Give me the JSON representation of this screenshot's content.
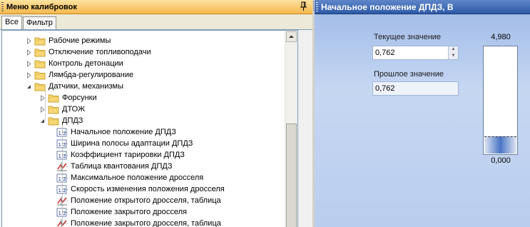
{
  "left_panel": {
    "title": "Меню калибровок",
    "tabs": [
      "Все",
      "Фильтр"
    ],
    "tree": {
      "items": [
        {
          "label": "Рабочие режимы",
          "kind": "folder"
        },
        {
          "label": "Отключение топливоподачи",
          "kind": "folder"
        },
        {
          "label": "Контроль детонации",
          "kind": "folder"
        },
        {
          "label": "Лямбда-регулирование",
          "kind": "folder"
        },
        {
          "label": "Датчики, механизмы",
          "kind": "folder"
        },
        {
          "label": "Форсунки",
          "kind": "folder"
        },
        {
          "label": "ДТОЖ",
          "kind": "folder"
        },
        {
          "label": "ДПДЗ",
          "kind": "folder"
        },
        {
          "label": "Начальное положение ДПДЗ",
          "kind": "value"
        },
        {
          "label": "Ширина полосы адаптации ДПДЗ",
          "kind": "value"
        },
        {
          "label": "Коэффициент тарировки ДПДЗ",
          "kind": "value"
        },
        {
          "label": "Таблица квантования ДПДЗ",
          "kind": "table"
        },
        {
          "label": "Максимальное положение дросселя",
          "kind": "value"
        },
        {
          "label": "Скорость изменения положения дросселя",
          "kind": "value"
        },
        {
          "label": "Положение открытого дросселя, таблица",
          "kind": "table"
        },
        {
          "label": "Положение закрытого дросселя",
          "kind": "value"
        },
        {
          "label": "Положение закрытого дросселя, таблица",
          "kind": "table"
        }
      ]
    }
  },
  "right_panel": {
    "title": "Начальное положение ДПДЗ, В",
    "current_label": "Текущее значение",
    "current_value": "0,762",
    "previous_label": "Прошлое значение",
    "previous_value": "0,762",
    "gauge": {
      "max_label": "4,980",
      "min_label": "0,000",
      "level": 0.153
    }
  },
  "colors": {
    "left_title": "#f5b84e",
    "right_title": "#2d5aa8",
    "gauge_fill": "#4a75c5"
  }
}
